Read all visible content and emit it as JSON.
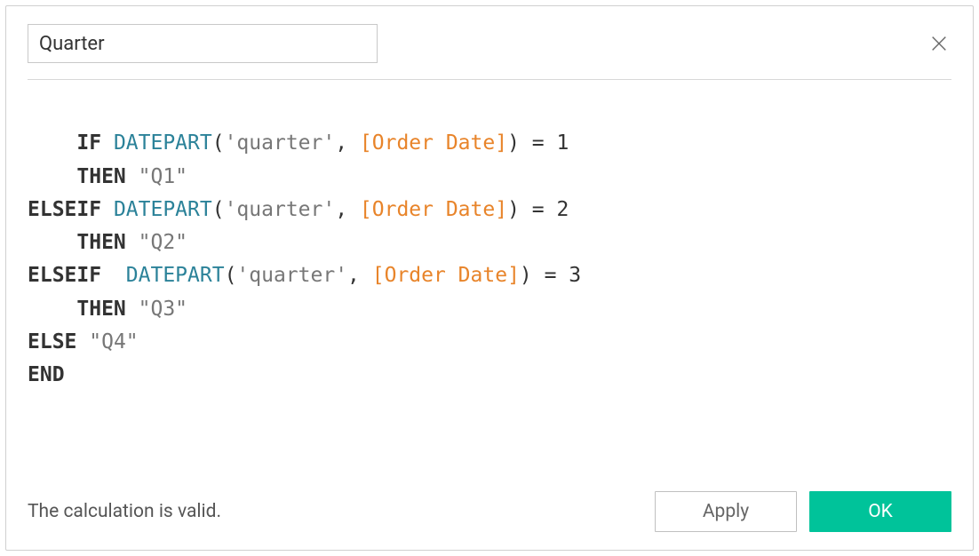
{
  "header": {
    "name_value": "Quarter"
  },
  "formula": {
    "tokens": [
      {
        "t": "kw",
        "v": "IF "
      },
      {
        "t": "fn",
        "v": "DATEPART"
      },
      {
        "t": "plain",
        "v": "("
      },
      {
        "t": "str",
        "v": "'quarter'"
      },
      {
        "t": "plain",
        "v": ", "
      },
      {
        "t": "field",
        "v": "[Order Date]"
      },
      {
        "t": "plain",
        "v": ") = 1"
      },
      {
        "t": "nl",
        "v": ""
      },
      {
        "t": "plain",
        "v": "    "
      },
      {
        "t": "kw",
        "v": "THEN "
      },
      {
        "t": "str",
        "v": "\"Q1\""
      },
      {
        "t": "nl",
        "v": ""
      },
      {
        "t": "kw",
        "v": "ELSEIF "
      },
      {
        "t": "fn",
        "v": "DATEPART"
      },
      {
        "t": "plain",
        "v": "("
      },
      {
        "t": "str",
        "v": "'quarter'"
      },
      {
        "t": "plain",
        "v": ", "
      },
      {
        "t": "field",
        "v": "[Order Date]"
      },
      {
        "t": "plain",
        "v": ") = 2"
      },
      {
        "t": "nl",
        "v": ""
      },
      {
        "t": "plain",
        "v": "    "
      },
      {
        "t": "kw",
        "v": "THEN "
      },
      {
        "t": "str",
        "v": "\"Q2\""
      },
      {
        "t": "nl",
        "v": ""
      },
      {
        "t": "kw",
        "v": "ELSEIF  "
      },
      {
        "t": "fn",
        "v": "DATEPART"
      },
      {
        "t": "plain",
        "v": "("
      },
      {
        "t": "str",
        "v": "'quarter'"
      },
      {
        "t": "plain",
        "v": ", "
      },
      {
        "t": "field",
        "v": "[Order Date]"
      },
      {
        "t": "plain",
        "v": ") = 3"
      },
      {
        "t": "nl",
        "v": ""
      },
      {
        "t": "plain",
        "v": "    "
      },
      {
        "t": "kw",
        "v": "THEN "
      },
      {
        "t": "str",
        "v": "\"Q3\""
      },
      {
        "t": "nl",
        "v": ""
      },
      {
        "t": "kw",
        "v": "ELSE "
      },
      {
        "t": "str",
        "v": "\"Q4\""
      },
      {
        "t": "nl",
        "v": ""
      },
      {
        "t": "kw",
        "v": "END"
      }
    ]
  },
  "footer": {
    "status": "The calculation is valid.",
    "apply_label": "Apply",
    "ok_label": "OK"
  }
}
